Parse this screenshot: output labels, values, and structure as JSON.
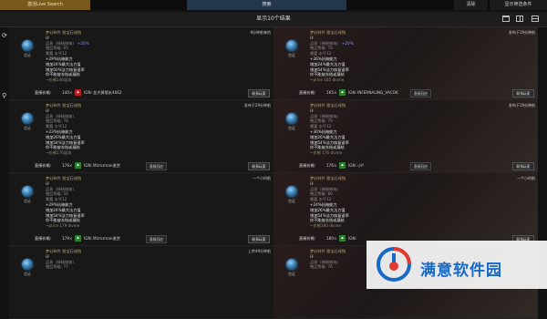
{
  "topbar": {
    "live_search": "激活Live Search",
    "search": "搜索",
    "clear": "清除",
    "conditions": "显示筛选条件"
  },
  "results": {
    "title": "显示10个结果"
  },
  "side_icons": {
    "refresh": "⟳",
    "magnify": "⚲"
  },
  "labels": {
    "verify": "验证",
    "price_label": "直接价格:",
    "contact": "联系玩家",
    "ign_prefix": "IGN:",
    "direct_buy": "直接回应"
  },
  "colors": {
    "accent": "#7a5a1c",
    "search": "#23364c",
    "name": "#c5a36a",
    "price_red": "#b22222",
    "price_green": "#2f7d2f"
  },
  "watermark": {
    "text": "满意软件园"
  },
  "cards": [
    {
      "listed": "9分钟前来的",
      "name": "梦幻碎片 星宝石戒指",
      "base": "环",
      "prop1": "品质（神秘修饰）",
      "prop1_val": "+20%",
      "prop2": "物品等级: 65",
      "prop3": "需要 水平12",
      "mods": [
        "+29%抗暗能力",
        "增加24%最大法力值",
        "增加50%法力恢复速率",
        "你不能被冻结或凝结"
      ],
      "note": "~价格146混沌",
      "price": "140×",
      "badge": "red",
      "seller": "金大黄哦米4662",
      "option": "",
      "bg": false
    },
    {
      "listed": "发布于19分钟前",
      "name": "梦幻碎片 星宝石戒指",
      "base": "环",
      "prop1": "品质（神秘修饰）",
      "prop1_val": "+20%",
      "prop2": "物品等级: 78",
      "prop3": "需要 水平12",
      "mods": [
        "+26%抗暗能力",
        "增加24%最大法力值",
        "增加54%法力恢复速率",
        "你不能被冻结或凝结"
      ],
      "note": "~price 165 divine",
      "price": "165×",
      "badge": "green",
      "seller": "INFERNALING_VACOK",
      "option": "直接回应",
      "bg": true
    },
    {
      "listed": "发布于29分钟前",
      "name": "梦幻碎片 星宝石戒指",
      "base": "环",
      "prop1": "品质（神秘修饰）",
      "prop1_val": "",
      "prop2": "物品等级: 78",
      "prop3": "需要 水平12",
      "mods": [
        "+23%抗暗能力",
        "增加26%最大法力值",
        "增加54%法力恢复速率",
        "你不能被冻结或凝结"
      ],
      "note": "~价格176混沌",
      "price": "176×",
      "badge": "green",
      "seller": "Mirrorman鉴赏",
      "option": "直接回应",
      "bg": false
    },
    {
      "listed": "发布于19分钟前",
      "name": "梦幻碎片 星宝石戒指",
      "base": "环",
      "prop1": "品质（神秘修饰）",
      "prop1_val": "",
      "prop2": "物品等级: 79",
      "prop3": "需要 水平12",
      "mods": [
        "+30%抗暗能力",
        "增加26%最大法力值",
        "增加54%法力恢复速率",
        "你不能被冻结或凝结"
      ],
      "note": "~价格 176 divine",
      "price": "176×",
      "badge": "green",
      "seller": "小P",
      "option": "直接回应",
      "bg": true
    },
    {
      "listed": "一个小时前",
      "name": "梦幻碎片 星宝石戒指",
      "base": "环",
      "prop1": "品质（神秘修饰）",
      "prop1_val": "",
      "prop2": "物品等级: 50",
      "prop3": "需要 水平12",
      "mods": [
        "+29%抗暗能力",
        "增加24%最大法力值",
        "增加54%法力恢复速率",
        "你不能被冻结或凝结"
      ],
      "note": "~price 179 divine",
      "price": "179×",
      "badge": "green",
      "seller": "Mirrorman鉴赏",
      "option": "直接回应",
      "bg": false
    },
    {
      "listed": "一个小时前",
      "name": "梦幻碎片 星宝石戒指",
      "base": "环",
      "prop1": "品质（神秘修饰）",
      "prop1_val": "",
      "prop2": "物品等级: 80",
      "prop3": "需要 水平12",
      "mods": [
        "+24%抗暗能力",
        "增加26%最大法力值",
        "增加54%法力恢复速率",
        "你不能被冻结或凝结"
      ],
      "note": "~价格180 divine",
      "price": "180×",
      "badge": "green",
      "seller": "",
      "option": "",
      "bg": true
    },
    {
      "listed": "上传49分钟前",
      "name": "梦幻碎片 星宝石戒指",
      "base": "环",
      "prop1": "品质（神秘修饰）",
      "prop1_val": "",
      "prop2": "物品等级: 77",
      "prop3": "",
      "mods": [],
      "note": "",
      "price": "",
      "badge": "",
      "seller": "",
      "option": "",
      "bg": false
    },
    {
      "listed": "",
      "name": "梦幻碎片 星宝石戒指",
      "base": "环",
      "prop1": "品质（神秘修饰）",
      "prop1_val": "",
      "prop2": "物品等级: 76",
      "prop3": "",
      "mods": [],
      "note": "",
      "price": "",
      "badge": "",
      "seller": "",
      "option": "",
      "bg": true
    }
  ]
}
